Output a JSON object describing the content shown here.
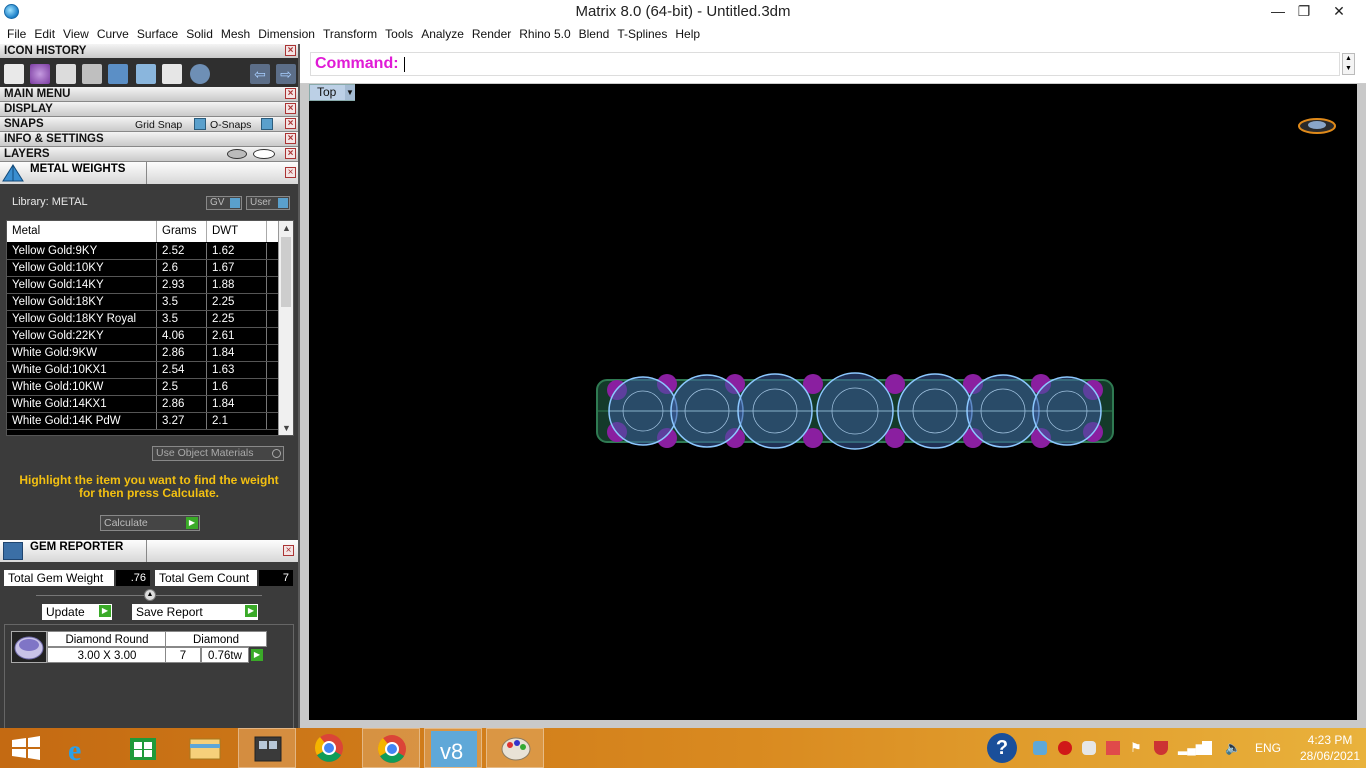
{
  "window": {
    "title": "Matrix 8.0 (64-bit) - Untitled.3dm",
    "minimize": "—",
    "maximize": "❐",
    "close": "✕"
  },
  "menu": [
    "File",
    "Edit",
    "View",
    "Curve",
    "Surface",
    "Solid",
    "Mesh",
    "Dimension",
    "Transform",
    "Tools",
    "Analyze",
    "Render",
    "Rhino 5.0",
    "Blend",
    "T-Splines",
    "Help"
  ],
  "panels": {
    "icon_history": "ICON HISTORY",
    "main_menu": "MAIN MENU",
    "display": "DISPLAY",
    "snaps": "SNAPS",
    "grid_snap": "Grid Snap",
    "o_snaps": "O-Snaps",
    "info_settings": "INFO & SETTINGS",
    "layers": "LAYERS"
  },
  "metal_weights": {
    "title": "METAL WEIGHTS",
    "library_label": "Library: METAL",
    "gv_button": "GV",
    "user_button": "User",
    "columns": [
      "Metal",
      "Grams",
      "DWT"
    ],
    "rows": [
      {
        "metal": "Yellow Gold:9KY",
        "grams": "2.52",
        "dwt": "1.62"
      },
      {
        "metal": "Yellow Gold:10KY",
        "grams": "2.6",
        "dwt": "1.67"
      },
      {
        "metal": "Yellow Gold:14KY",
        "grams": "2.93",
        "dwt": "1.88"
      },
      {
        "metal": "Yellow Gold:18KY",
        "grams": "3.5",
        "dwt": "2.25"
      },
      {
        "metal": "Yellow Gold:18KY Royal",
        "grams": "3.5",
        "dwt": "2.25"
      },
      {
        "metal": "Yellow Gold:22KY",
        "grams": "4.06",
        "dwt": "2.61"
      },
      {
        "metal": "White Gold:9KW",
        "grams": "2.86",
        "dwt": "1.84"
      },
      {
        "metal": "White Gold:10KX1",
        "grams": "2.54",
        "dwt": "1.63"
      },
      {
        "metal": "White Gold:10KW",
        "grams": "2.5",
        "dwt": "1.6"
      },
      {
        "metal": "White Gold:14KX1",
        "grams": "2.86",
        "dwt": "1.84"
      },
      {
        "metal": "White Gold:14K PdW",
        "grams": "3.27",
        "dwt": "2.1"
      }
    ],
    "use_object_materials": "Use Object Materials",
    "hint": "Highlight the item you want to find the weight for then press Calculate.",
    "calculate": "Calculate"
  },
  "gem_reporter": {
    "title": "GEM REPORTER",
    "total_weight_label": "Total Gem Weight",
    "total_weight_value": ".76",
    "total_count_label": "Total Gem Count",
    "total_count_value": "7",
    "update": "Update",
    "save_report": "Save Report",
    "gem": {
      "shape": "Diamond Round",
      "material": "Diamond",
      "size": "3.00 X 3.00",
      "count": "7",
      "weight": "0.76tw"
    }
  },
  "command": {
    "label": "Command:",
    "value": ""
  },
  "viewport": {
    "name": "Top",
    "colors": {
      "background": "#000000",
      "gem_wire": "#8cc8ff",
      "prong": "#8a1fa0",
      "metal": "#2f7a52"
    }
  },
  "taskbar": {
    "language": "ENG",
    "time": "4:23 PM",
    "date": "28/06/2021"
  },
  "icons": {
    "app": "matrix-app-icon",
    "start": "windows-start-icon",
    "ie": "internet-explorer-icon",
    "store": "store-icon",
    "explorer": "file-explorer-icon",
    "matrix": "matrix-taskbar-icon",
    "chrome": "chrome-icon",
    "vsphere": "vectorworks-icon",
    "paint": "paint-icon",
    "help": "help-icon"
  }
}
